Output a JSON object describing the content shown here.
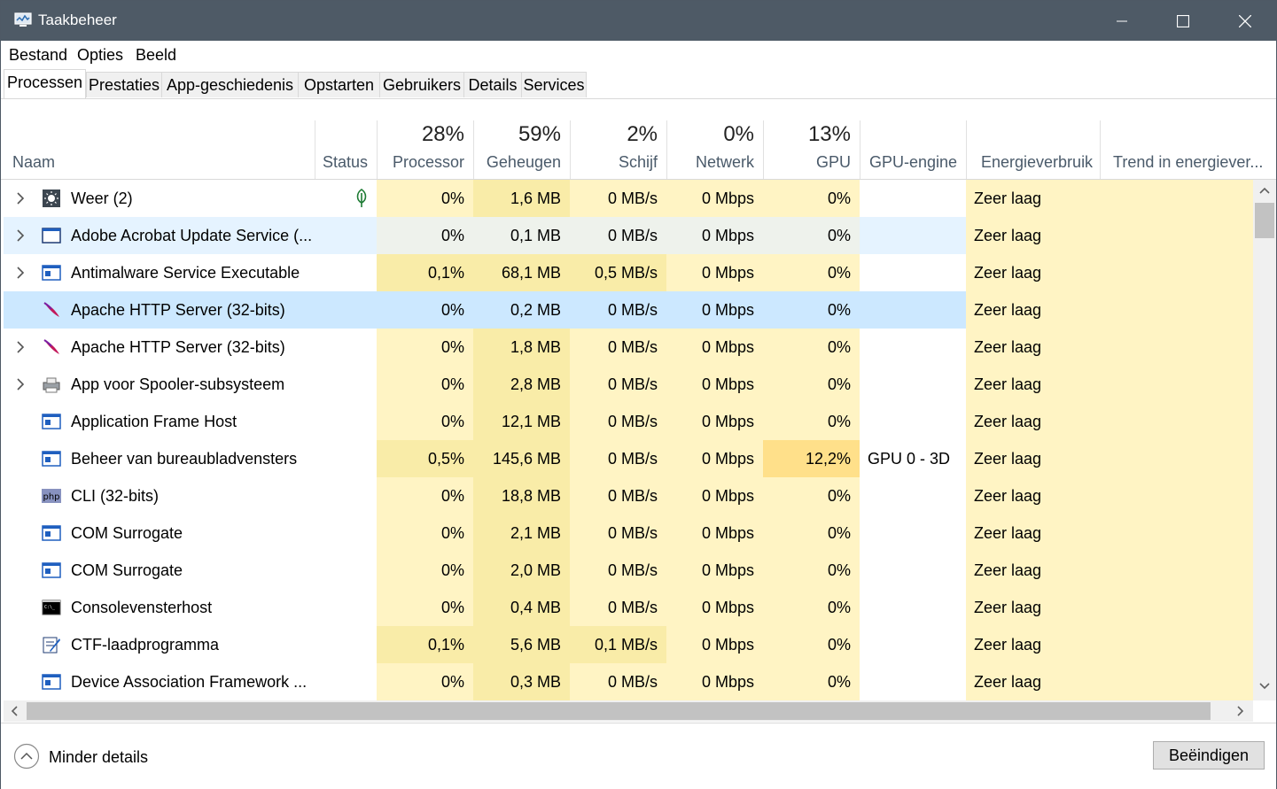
{
  "window": {
    "title": "Taakbeheer"
  },
  "menu": [
    "Bestand",
    "Opties",
    "Beeld"
  ],
  "tabs": [
    "Processen",
    "Prestaties",
    "App-geschiedenis",
    "Opstarten",
    "Gebruikers",
    "Details",
    "Services"
  ],
  "columns": {
    "name": "Naam",
    "status": "Status",
    "cpu": {
      "pct": "28%",
      "label": "Processor"
    },
    "mem": {
      "pct": "59%",
      "label": "Geheugen"
    },
    "disk": {
      "pct": "2%",
      "label": "Schijf"
    },
    "net": {
      "pct": "0%",
      "label": "Netwerk"
    },
    "gpu": {
      "pct": "13%",
      "label": "GPU"
    },
    "gpu_engine": "GPU-engine",
    "power": "Energieverbruik",
    "power_trend": "Trend in energiever..."
  },
  "processes": [
    {
      "name": "Weer (2)",
      "icon": "weather-icon",
      "expandable": true,
      "status_icon": "leaf-icon",
      "cpu": "0%",
      "mem": "1,6 MB",
      "disk": "0 MB/s",
      "net": "0 Mbps",
      "gpu": "0%",
      "gpu_engine": "",
      "power": "Zeer laag"
    },
    {
      "name": "Adobe Acrobat Update Service (...",
      "icon": "service-window-icon",
      "expandable": true,
      "cpu": "0%",
      "mem": "0,1 MB",
      "disk": "0 MB/s",
      "net": "0 Mbps",
      "gpu": "0%",
      "gpu_engine": "",
      "power": "Zeer laag"
    },
    {
      "name": "Antimalware Service Executable",
      "icon": "app-window-icon",
      "expandable": true,
      "cpu": "0,1%",
      "mem": "68,1 MB",
      "disk": "0,5 MB/s",
      "net": "0 Mbps",
      "gpu": "0%",
      "gpu_engine": "",
      "power": "Zeer laag"
    },
    {
      "name": "Apache HTTP Server (32-bits)",
      "icon": "apache-feather-icon",
      "expandable": false,
      "selected": true,
      "cpu": "0%",
      "mem": "0,2 MB",
      "disk": "0 MB/s",
      "net": "0 Mbps",
      "gpu": "0%",
      "gpu_engine": "",
      "power": "Zeer laag"
    },
    {
      "name": "Apache HTTP Server (32-bits)",
      "icon": "apache-feather-icon",
      "expandable": true,
      "cpu": "0%",
      "mem": "1,8 MB",
      "disk": "0 MB/s",
      "net": "0 Mbps",
      "gpu": "0%",
      "gpu_engine": "",
      "power": "Zeer laag"
    },
    {
      "name": "App voor Spooler-subsysteem",
      "icon": "printer-icon",
      "expandable": true,
      "cpu": "0%",
      "mem": "2,8 MB",
      "disk": "0 MB/s",
      "net": "0 Mbps",
      "gpu": "0%",
      "gpu_engine": "",
      "power": "Zeer laag"
    },
    {
      "name": "Application Frame Host",
      "icon": "app-window-icon",
      "expandable": false,
      "cpu": "0%",
      "mem": "12,1 MB",
      "disk": "0 MB/s",
      "net": "0 Mbps",
      "gpu": "0%",
      "gpu_engine": "",
      "power": "Zeer laag"
    },
    {
      "name": "Beheer van bureaubladvensters",
      "icon": "app-window-icon",
      "expandable": false,
      "cpu": "0,5%",
      "mem": "145,6 MB",
      "disk": "0 MB/s",
      "net": "0 Mbps",
      "gpu": "12,2%",
      "gpu_engine": "GPU 0 - 3D",
      "power": "Zeer laag"
    },
    {
      "name": "CLI (32-bits)",
      "icon": "php-icon",
      "expandable": false,
      "cpu": "0%",
      "mem": "18,8 MB",
      "disk": "0 MB/s",
      "net": "0 Mbps",
      "gpu": "0%",
      "gpu_engine": "",
      "power": "Zeer laag"
    },
    {
      "name": "COM Surrogate",
      "icon": "app-window-icon",
      "expandable": false,
      "cpu": "0%",
      "mem": "2,1 MB",
      "disk": "0 MB/s",
      "net": "0 Mbps",
      "gpu": "0%",
      "gpu_engine": "",
      "power": "Zeer laag"
    },
    {
      "name": "COM Surrogate",
      "icon": "app-window-icon",
      "expandable": false,
      "cpu": "0%",
      "mem": "2,0 MB",
      "disk": "0 MB/s",
      "net": "0 Mbps",
      "gpu": "0%",
      "gpu_engine": "",
      "power": "Zeer laag"
    },
    {
      "name": "Consolevensterhost",
      "icon": "console-icon",
      "expandable": false,
      "cpu": "0%",
      "mem": "0,4 MB",
      "disk": "0 MB/s",
      "net": "0 Mbps",
      "gpu": "0%",
      "gpu_engine": "",
      "power": "Zeer laag"
    },
    {
      "name": "CTF-laadprogramma",
      "icon": "ctf-pen-icon",
      "expandable": false,
      "cpu": "0,1%",
      "mem": "5,6 MB",
      "disk": "0,1 MB/s",
      "net": "0 Mbps",
      "gpu": "0%",
      "gpu_engine": "",
      "power": "Zeer laag"
    },
    {
      "name": "Device Association Framework ...",
      "icon": "app-window-icon",
      "expandable": false,
      "cpu": "0%",
      "mem": "0,3 MB",
      "disk": "0 MB/s",
      "net": "0 Mbps",
      "gpu": "0%",
      "gpu_engine": "",
      "power": "Zeer laag"
    }
  ],
  "footer": {
    "fewer_details": "Minder details",
    "end_task": "Beëindigen"
  },
  "colors": {
    "titlebar": "#4e5a66",
    "heat_light": "#fff4c4",
    "heat_mid": "#f9eca8",
    "heat_strong": "#ffe08a",
    "selected": "#cce8ff",
    "hover": "#e5f3ff"
  }
}
